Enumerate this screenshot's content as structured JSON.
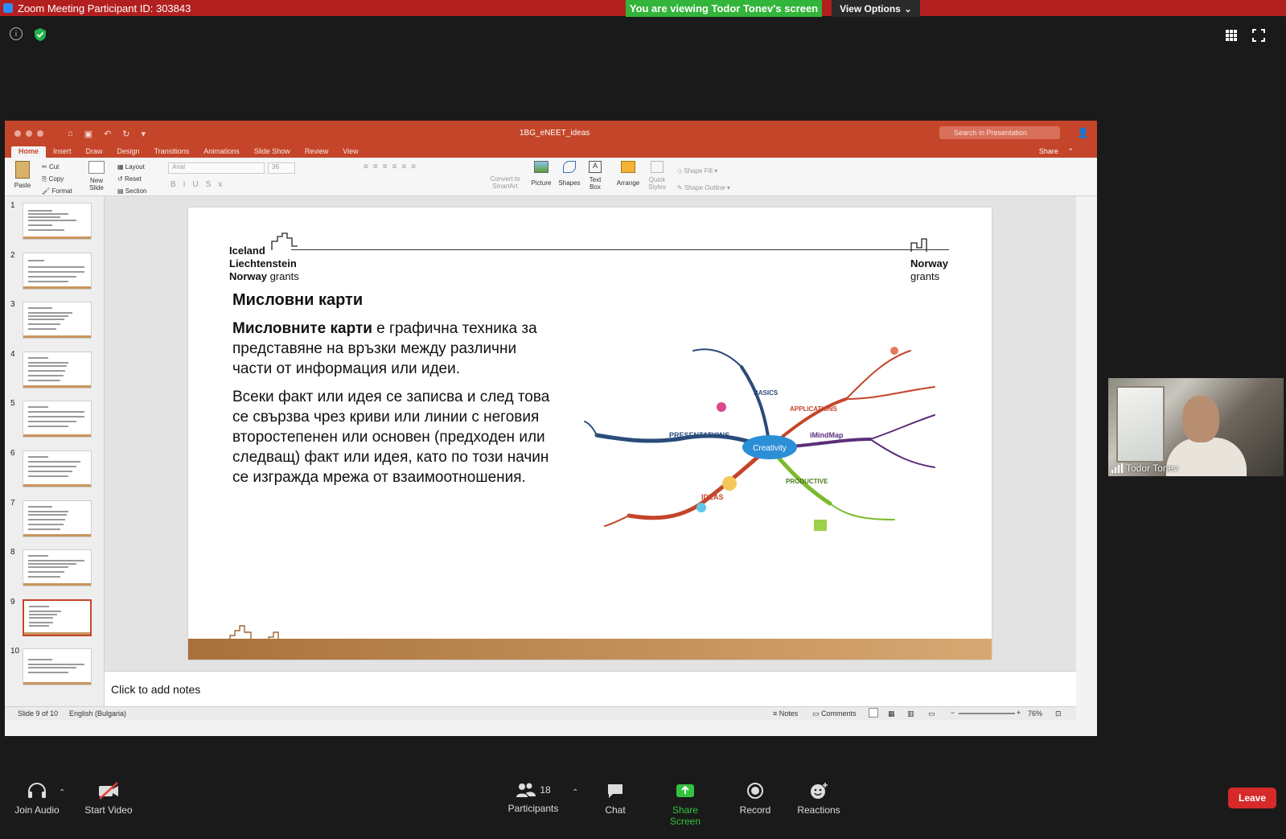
{
  "zoom": {
    "title": "Zoom Meeting Participant ID: 303843",
    "viewing_banner": "You are viewing Todor Tonev's screen",
    "view_options": "View Options"
  },
  "ppt": {
    "filename": "1BG_eNEET_ideas",
    "search_placeholder": "Search in Presentation",
    "tabs": [
      "Home",
      "Insert",
      "Draw",
      "Design",
      "Transitions",
      "Animations",
      "Slide Show",
      "Review",
      "View"
    ],
    "share": "Share",
    "ribbon": {
      "paste": "Paste",
      "cut": "Cut",
      "copy": "Copy",
      "format": "Format",
      "new_slide": "New Slide",
      "layout": "Layout",
      "reset": "Reset",
      "section": "Section",
      "font": "Arial",
      "font_size": "36",
      "convert_smartart": "Convert to SmartArt",
      "picture": "Picture",
      "shapes": "Shapes",
      "text_box": "Text Box",
      "arrange": "Arrange",
      "quick_styles": "Quick Styles",
      "shape_fill": "Shape Fill",
      "shape_outline": "Shape Outline"
    },
    "thumbnails": [
      "1",
      "2",
      "3",
      "4",
      "5",
      "6",
      "7",
      "8",
      "9",
      "10"
    ],
    "selected_slide": 9,
    "slide": {
      "logo_line1": "Iceland",
      "logo_line2": "Liechtenstein",
      "logo_line3_bold": "Norway",
      "logo_line3_rest": " grants",
      "norway_line1": "Norway",
      "norway_line2": "grants",
      "title": "Мисловни карти",
      "para1_bold": "Мисловните карти",
      "para1_rest": " е графична техника за представяне на връзки между различни части от информация или идеи.",
      "para2": "Всеки факт или идея се записва и след това се свързва чрез криви или линии с неговия второстепенен или основен (предходен или следващ) факт или идея, като по този начин се изгражда мрежа от взаимоотношения.",
      "mindmap_center": "Creativity",
      "mindmap_branches": [
        "PRESENTATIONS",
        "IDEAS",
        "PRODUCTIVE",
        "BASICS",
        "APPLICATIONS",
        "iMindMap"
      ]
    },
    "notes_placeholder": "Click to add notes",
    "status": {
      "slide_of": "Slide 9 of 10",
      "language": "English (Bulgaria)",
      "notes": "Notes",
      "comments": "Comments",
      "zoom": "76%"
    }
  },
  "video": {
    "participant_name": "Todor Tonev"
  },
  "toolbar": {
    "join_audio": "Join Audio",
    "start_video": "Start Video",
    "participants": "Participants",
    "participants_count": "18",
    "chat": "Chat",
    "share_screen": "Share Screen",
    "record": "Record",
    "reactions": "Reactions",
    "leave": "Leave"
  },
  "colors": {
    "zoom_red": "#b21f1f",
    "banner_green": "#33b43a",
    "ppt_accent": "#c4452a",
    "leave_red": "#d6292a"
  }
}
